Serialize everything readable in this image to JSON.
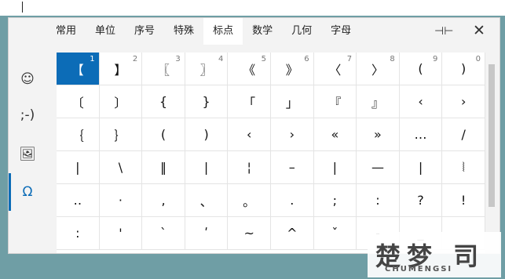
{
  "tabs": [
    "常用",
    "单位",
    "序号",
    "特殊",
    "标点",
    "数学",
    "几何",
    "字母"
  ],
  "selected_tab": "标点",
  "sidebar": [
    {
      "name": "emoji-icon",
      "glyph": "☺"
    },
    {
      "name": "kaomoji-icon",
      "glyph": ";-)"
    },
    {
      "name": "image-icon",
      "glyph": "🖼"
    },
    {
      "name": "omega-icon",
      "glyph": "Ω"
    }
  ],
  "pin_glyph": "⊣⊢",
  "close_glyph": "✕",
  "symbol_rows": [
    [
      [
        "【",
        "1"
      ],
      [
        "】",
        "2"
      ],
      [
        "〖",
        "3"
      ],
      [
        "〗",
        "4"
      ],
      [
        "《",
        "5"
      ],
      [
        "》",
        "6"
      ],
      [
        "〈",
        "7"
      ],
      [
        "〉",
        "8"
      ],
      [
        "(",
        "9"
      ],
      [
        ")",
        "0"
      ]
    ],
    [
      [
        "〔",
        ""
      ],
      [
        "〕",
        ""
      ],
      [
        "{",
        ""
      ],
      [
        "}",
        ""
      ],
      [
        "「",
        ""
      ],
      [
        "」",
        ""
      ],
      [
        "『",
        ""
      ],
      [
        "』",
        ""
      ],
      [
        "‹",
        ""
      ],
      [
        "›",
        ""
      ]
    ],
    [
      [
        "｛",
        ""
      ],
      [
        "｝",
        ""
      ],
      [
        "(",
        ""
      ],
      [
        ")",
        ""
      ],
      [
        "‹",
        ""
      ],
      [
        "›",
        ""
      ],
      [
        "«",
        ""
      ],
      [
        "»",
        ""
      ],
      [
        "…",
        ""
      ],
      [
        "/",
        ""
      ]
    ],
    [
      [
        "|",
        ""
      ],
      [
        "\\",
        ""
      ],
      [
        "‖",
        ""
      ],
      [
        "|",
        ""
      ],
      [
        "¦",
        ""
      ],
      [
        "–",
        ""
      ],
      [
        "|",
        ""
      ],
      [
        "—",
        ""
      ],
      [
        "|",
        ""
      ],
      [
        "⦚",
        ""
      ]
    ],
    [
      [
        "‥",
        ""
      ],
      [
        "·",
        ""
      ],
      [
        ",",
        ""
      ],
      [
        "、",
        ""
      ],
      [
        "。",
        ""
      ],
      [
        ".",
        ""
      ],
      [
        ";",
        ""
      ],
      [
        ":",
        ""
      ],
      [
        "?",
        ""
      ],
      [
        "!",
        ""
      ]
    ],
    [
      [
        ":",
        ""
      ],
      [
        "'",
        ""
      ],
      [
        "`",
        ""
      ],
      [
        "ʹ",
        ""
      ],
      [
        "~",
        ""
      ],
      [
        "^",
        ""
      ],
      [
        "ˇ",
        ""
      ],
      [
        "-",
        ""
      ],
      [
        "_",
        ""
      ],
      [
        "",
        ""
      ]
    ]
  ],
  "watermark": {
    "big": "楚梦 司",
    "small": "CHUMENGSI"
  },
  "colors": {
    "accent": "#0c6cb7",
    "background": "#6f9ea5"
  }
}
